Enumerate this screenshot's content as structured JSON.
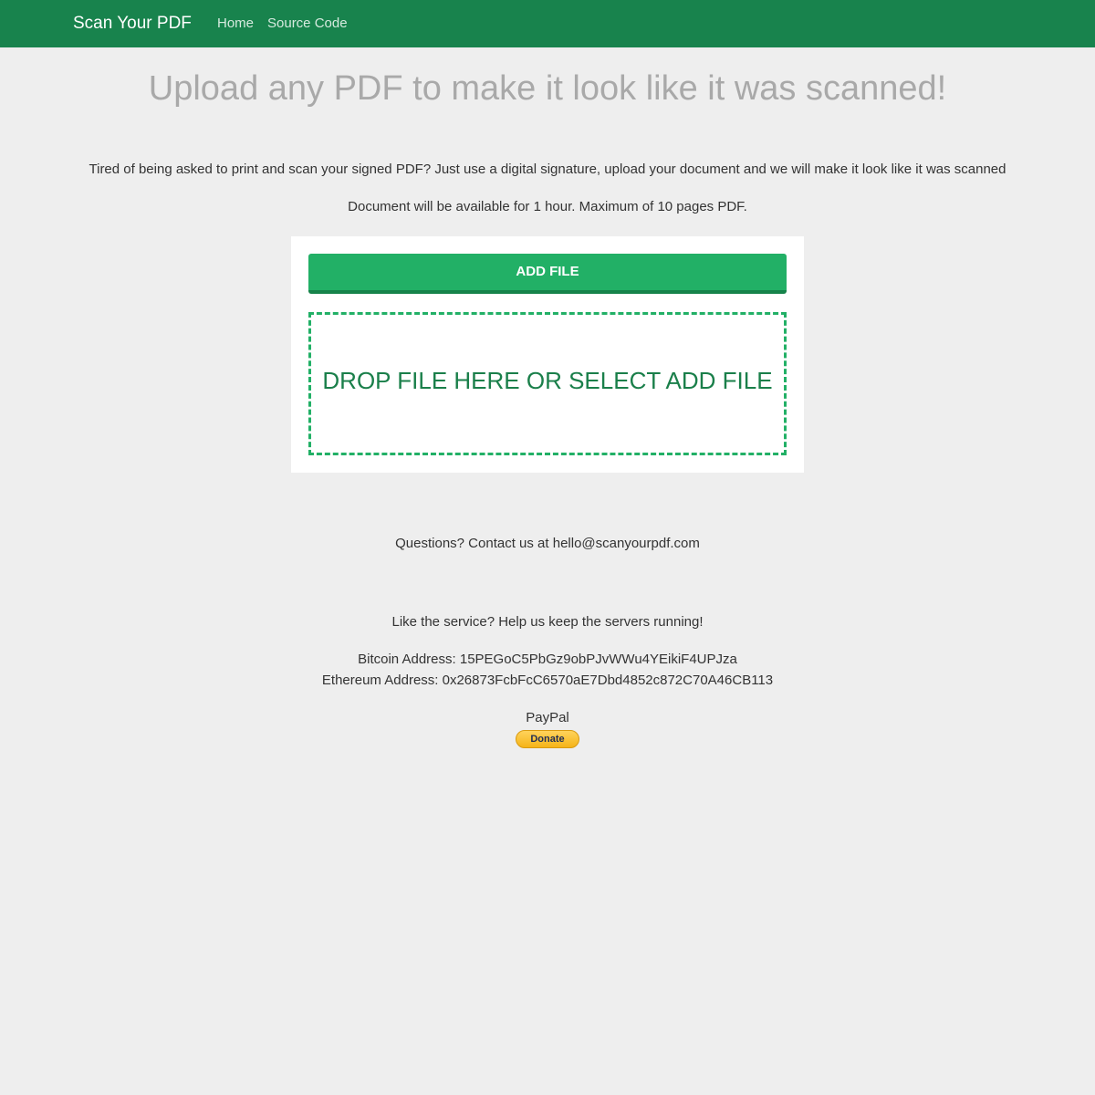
{
  "navbar": {
    "brand": "Scan Your PDF",
    "links": [
      "Home",
      "Source Code"
    ]
  },
  "main": {
    "headline": "Upload any PDF to make it look like it was scanned!",
    "intro": "Tired of being asked to print and scan your signed PDF? Just use a digital signature, upload your document and we will make it look like it was scanned",
    "availability": "Document will be available for 1 hour. Maximum of 10 pages PDF."
  },
  "upload": {
    "add_file_label": "ADD FILE",
    "dropzone_text": "DROP FILE HERE OR SELECT ADD FILE"
  },
  "footer": {
    "contact": "Questions? Contact us at hello@scanyourpdf.com",
    "support": "Like the service? Help us keep the servers running!",
    "bitcoin": "Bitcoin Address: 15PEGoC5PbGz9obPJvWWu4YEikiF4UPJza",
    "ethereum": "Ethereum Address: 0x26873FcbFcC6570aE7Dbd4852c872C70A46CB113",
    "paypal_label": "PayPal",
    "donate_label": "Donate"
  },
  "colors": {
    "navbar": "#18834d",
    "accent": "#22b066",
    "background": "#eeeeee"
  }
}
